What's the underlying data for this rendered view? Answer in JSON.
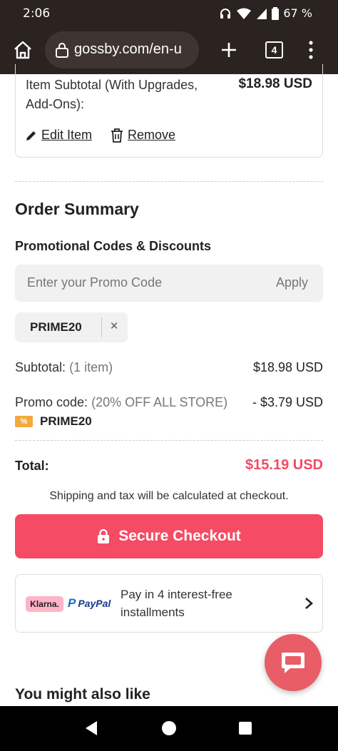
{
  "status_bar": {
    "time": "2:06",
    "battery": "67 %"
  },
  "browser": {
    "url": "gossby.com/en-u",
    "tab_count": "4"
  },
  "item_card": {
    "subtotal_label": "Item Subtotal (With Upgrades, Add-Ons):",
    "subtotal_value": "$18.98 USD",
    "edit_label": "Edit Item",
    "remove_label": "Remove"
  },
  "order_summary": {
    "title": "Order Summary",
    "promo_heading": "Promotional Codes & Discounts",
    "promo_placeholder": "Enter your Promo Code",
    "apply_label": "Apply",
    "applied_code": "PRIME20",
    "remove_code_symbol": "×",
    "subtotal_label": "Subtotal:",
    "subtotal_count": "(1 item)",
    "subtotal_value": "$18.98 USD",
    "promo_label": "Promo code:",
    "promo_desc": "(20% OFF ALL STORE)",
    "promo_value": "- $3.79 USD",
    "promo_tag_icon": "%",
    "promo_tag": "PRIME20",
    "total_label": "Total:",
    "total_value": "$15.19 USD",
    "shipping_note": "Shipping and tax will be calculated at checkout.",
    "checkout_label": "Secure Checkout"
  },
  "payment": {
    "klarna_label": "Klarna.",
    "paypal_label": "PayPal",
    "text": "Pay in 4 interest-free installments"
  },
  "recommendations": {
    "title": "You might also like"
  },
  "colors": {
    "accent": "#f54b64",
    "total": "#f24b63",
    "chat_fab": "#e95d67",
    "browser_bar": "#2a2320"
  },
  "icons": [
    "home-icon",
    "lock-icon",
    "plus-icon",
    "tabs-icon",
    "more-vert-icon",
    "pencil-icon",
    "trash-icon",
    "close-icon",
    "percent-tag-icon",
    "padlock-icon",
    "chevron-right-icon",
    "chat-icon",
    "nav-back-icon",
    "nav-home-icon",
    "nav-recents-icon"
  ]
}
